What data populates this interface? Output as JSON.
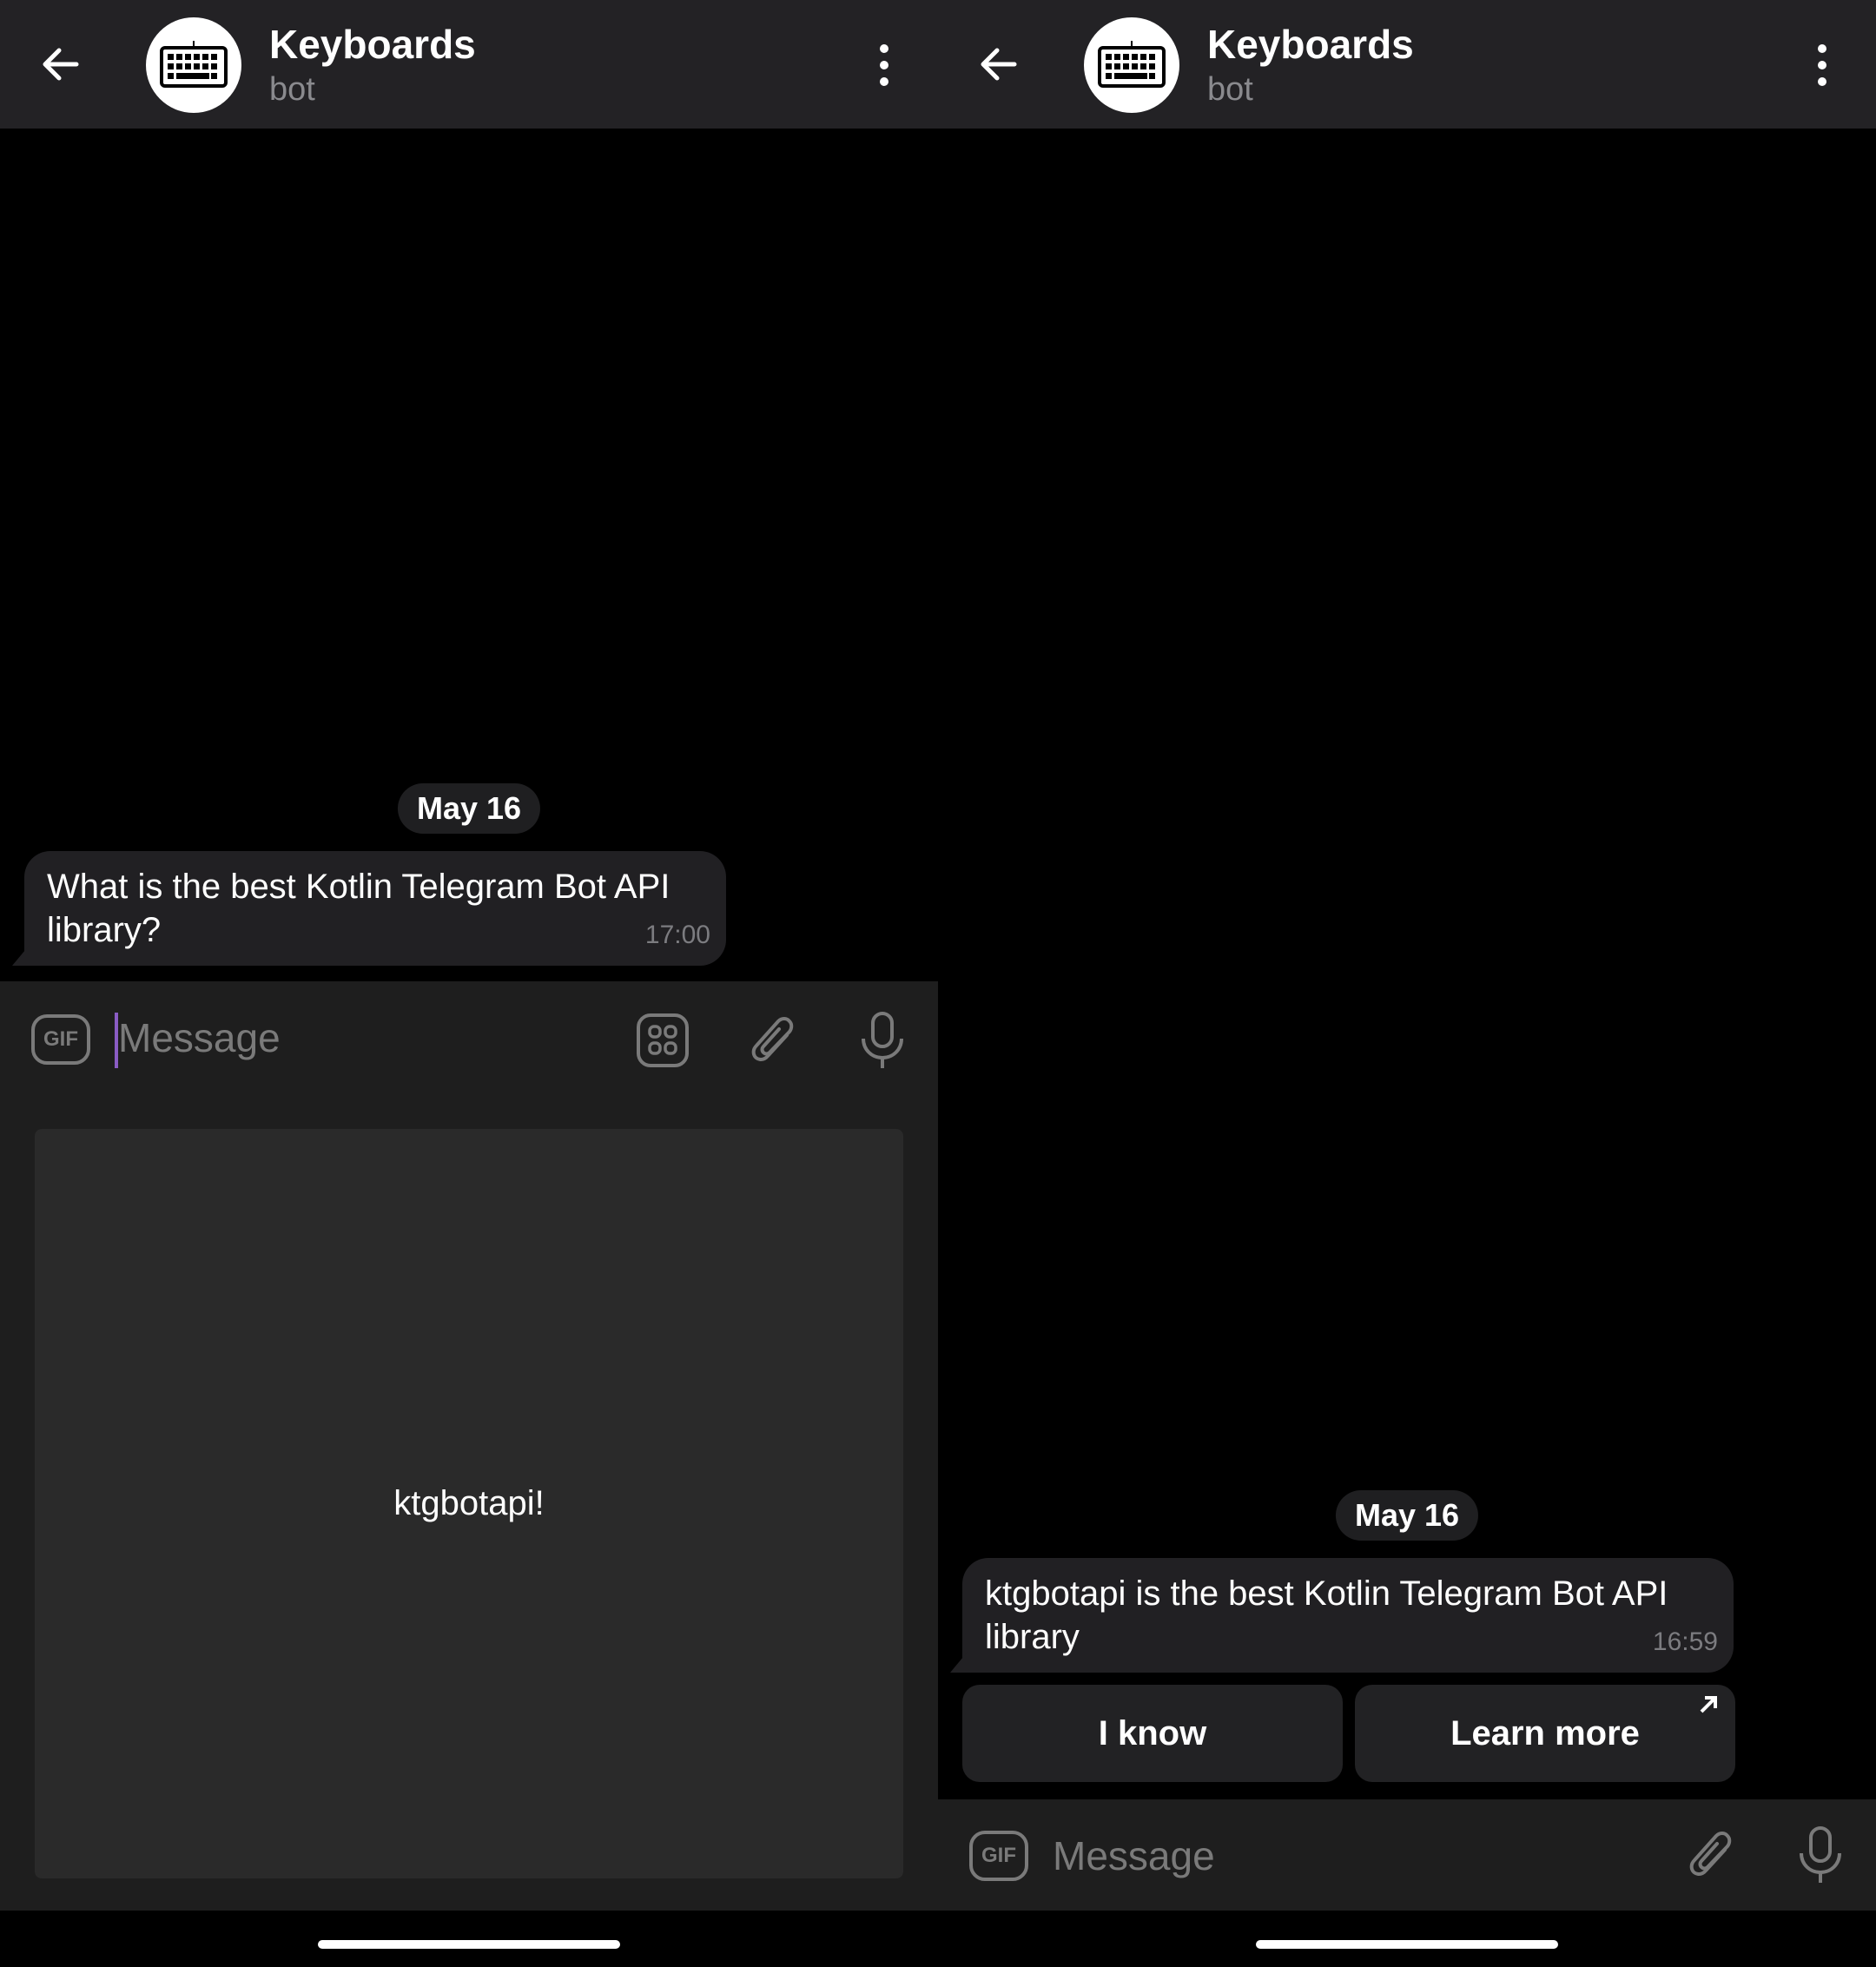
{
  "panels": [
    {
      "header": {
        "title": "Keyboards",
        "subtitle": "bot",
        "avatar_icon": "keyboard-icon"
      },
      "date_label": "May 16",
      "message": {
        "text": "What is the best Kotlin Telegram Bot API library?",
        "time": "17:00"
      },
      "input": {
        "gif_label": "GIF",
        "placeholder": "Message"
      },
      "reply_keyboard": {
        "buttons": [
          "ktgbotapi!"
        ]
      }
    },
    {
      "header": {
        "title": "Keyboards",
        "subtitle": "bot",
        "avatar_icon": "keyboard-icon"
      },
      "date_label": "May 16",
      "message": {
        "text": "ktgbotapi is the best Kotlin Telegram Bot API library",
        "time": "16:59"
      },
      "inline_keyboard": {
        "buttons": [
          {
            "label": "I know",
            "url": false
          },
          {
            "label": "Learn more",
            "url": true
          }
        ]
      },
      "input": {
        "gif_label": "GIF",
        "placeholder": "Message"
      }
    }
  ],
  "colors": {
    "header_bg": "#232225",
    "bubble_bg": "#212023",
    "caret": "#8a5cc4",
    "keyboard_button_bg": "#2a2a2a"
  }
}
